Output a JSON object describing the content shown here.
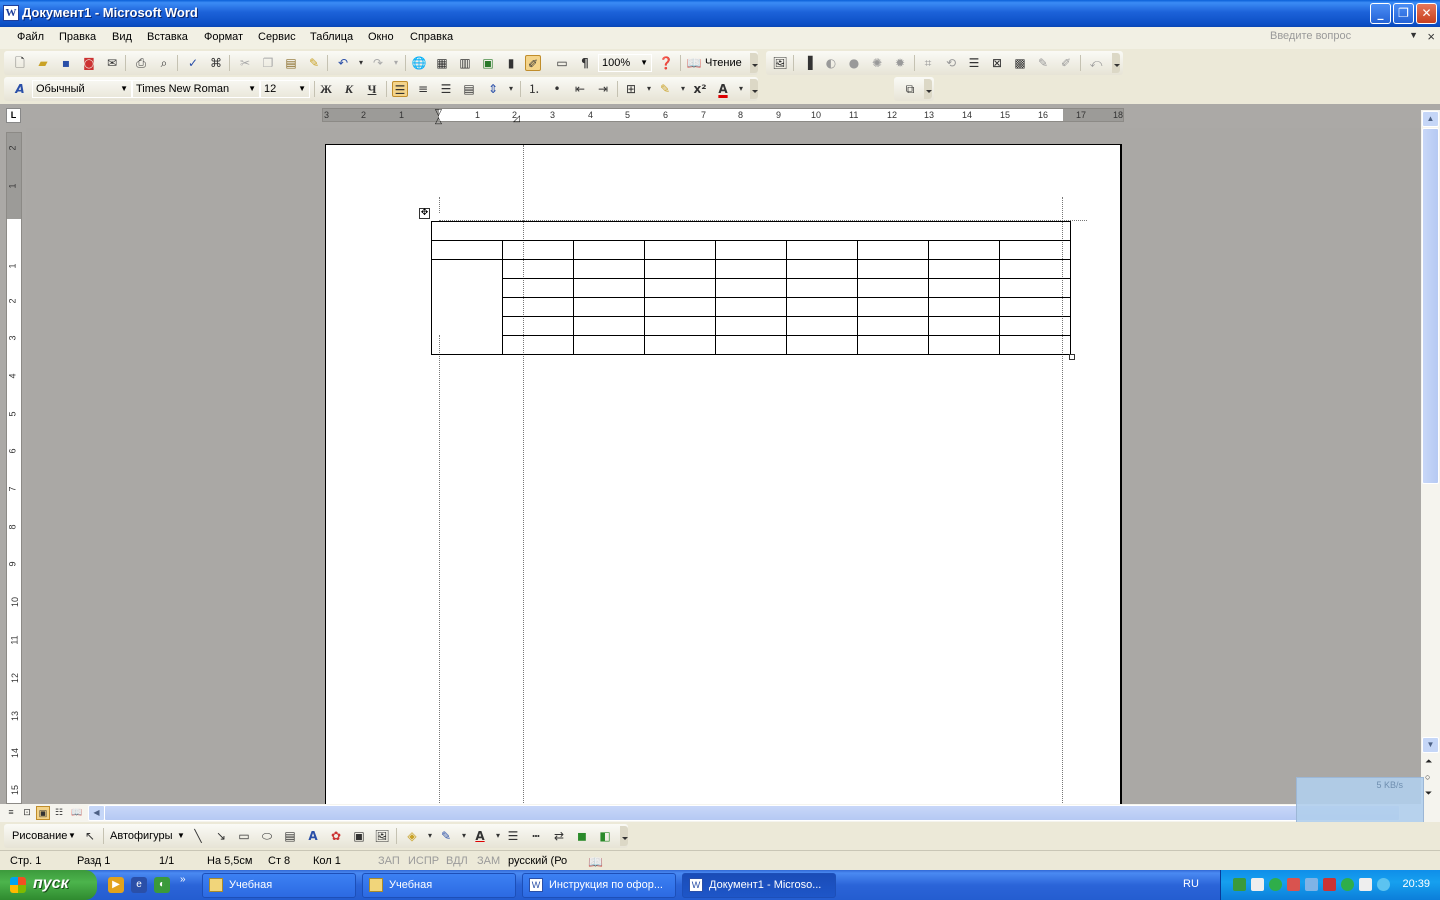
{
  "window": {
    "title": "Документ1 - Microsoft Word",
    "minimize": "_",
    "restore": "❐",
    "close": "✕"
  },
  "menu": {
    "items": [
      "Файл",
      "Правка",
      "Вид",
      "Вставка",
      "Формат",
      "Сервис",
      "Таблица",
      "Окно",
      "Справка"
    ],
    "ask_placeholder": "Введите вопрос",
    "close_doc": "×"
  },
  "standard_toolbar": {
    "zoom": "100%",
    "reading_label": "Чтение"
  },
  "formatting_toolbar": {
    "style": "Обычный",
    "font": "Times New Roman",
    "size": "12",
    "bold": "Ж",
    "italic": "К",
    "underline": "Ч"
  },
  "ruler": {
    "tab_marker": "L",
    "h_numbers": [
      "3",
      "2",
      "1",
      "1",
      "2",
      "3",
      "4",
      "5",
      "6",
      "7",
      "8",
      "9",
      "10",
      "11",
      "12",
      "13",
      "14",
      "15",
      "16",
      "17",
      "18"
    ],
    "v_numbers": [
      "2",
      "1",
      "1",
      "2",
      "3",
      "4",
      "5",
      "6",
      "7",
      "8",
      "9",
      "10",
      "11",
      "12",
      "13",
      "14",
      "15"
    ]
  },
  "document": {
    "table": {
      "rows": 6,
      "columns": 9
    }
  },
  "draw_toolbar": {
    "drawing_label": "Рисование",
    "autoshapes_label": "Автофигуры"
  },
  "status_bar": {
    "page": "Стр. 1",
    "section": "Разд 1",
    "pages": "1/1",
    "at": "На 5,5см",
    "line": "Ст 8",
    "column": "Кол 1",
    "rec": "ЗАП",
    "trk": "ИСПР",
    "ext": "ВДЛ",
    "ovr": "ЗАМ",
    "language": "русский (Ро"
  },
  "net_meter": {
    "speed": "5 KB/s"
  },
  "taskbar": {
    "start_label": "пуск",
    "tasks": [
      {
        "label": "Учебная",
        "active": false
      },
      {
        "label": "Учебная",
        "active": false
      },
      {
        "label": "Инструкция по офор...",
        "active": false
      },
      {
        "label": "Документ1 - Microso...",
        "active": true
      }
    ],
    "language": "RU",
    "time": "20:39"
  },
  "colors": {
    "titlebar": "#0a5fd8",
    "page_background": "#aaa8a5",
    "taskbar": "#245dd0",
    "start_button": "#3c9a3c"
  }
}
